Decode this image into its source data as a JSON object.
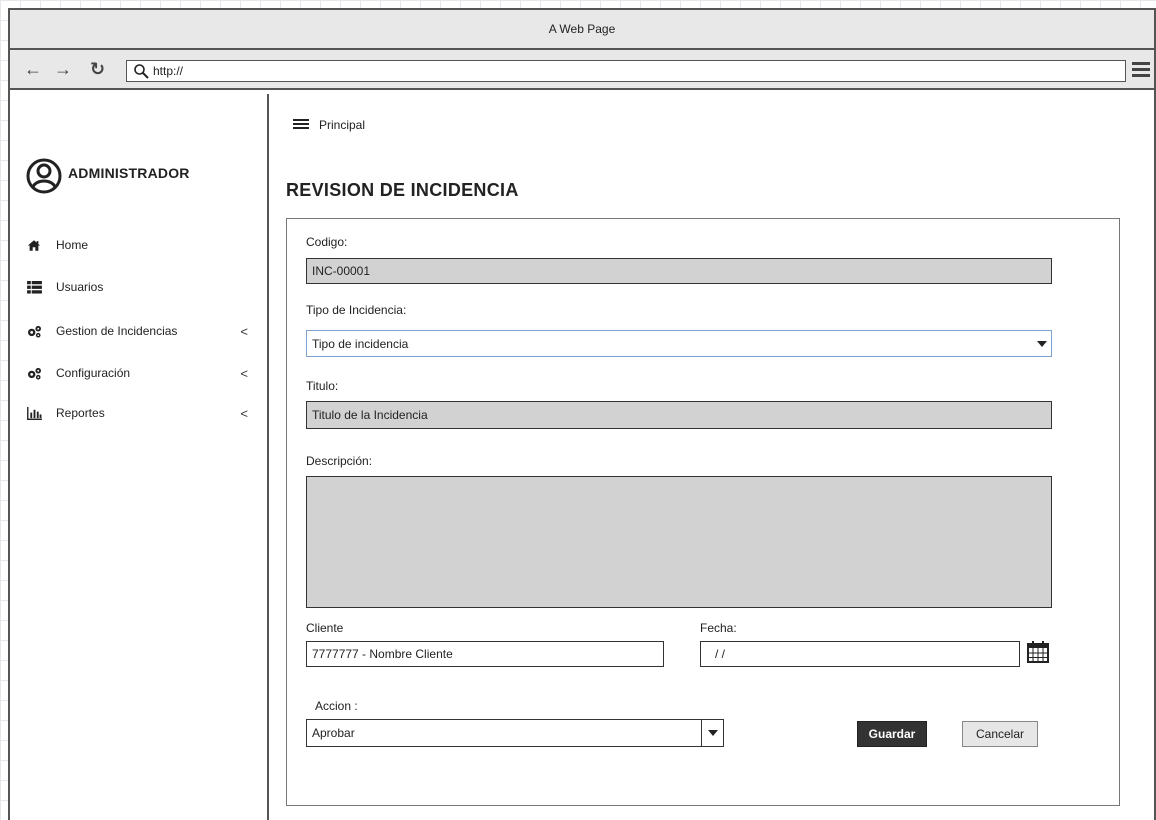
{
  "window": {
    "title": "A Web Page"
  },
  "browser": {
    "url": "http://"
  },
  "sidebar": {
    "user": "ADMINISTRADOR",
    "items": [
      {
        "label": "Home",
        "icon": "home-icon",
        "has_submenu": false
      },
      {
        "label": "Usuarios",
        "icon": "list-icon",
        "has_submenu": false
      },
      {
        "label": "Gestion de Incidencias",
        "icon": "cogs-icon",
        "has_submenu": true
      },
      {
        "label": "Configuración",
        "icon": "cogs-icon",
        "has_submenu": true
      },
      {
        "label": "Reportes",
        "icon": "bar-chart-icon",
        "has_submenu": true
      }
    ],
    "chevron": "<"
  },
  "breadcrumb": {
    "label": "Principal"
  },
  "page": {
    "title": "REVISION DE INCIDENCIA"
  },
  "form": {
    "codigo": {
      "label": "Codigo:",
      "value": "INC-00001"
    },
    "tipo": {
      "label": "Tipo de Incidencia:",
      "value": "Tipo de incidencia"
    },
    "titulo": {
      "label": "Titulo:",
      "value": "Titulo de la Incidencia"
    },
    "descripcion": {
      "label": "Descripción:",
      "value": ""
    },
    "cliente": {
      "label": "Cliente",
      "value": "7777777 - Nombre Cliente"
    },
    "fecha": {
      "label": "Fecha:",
      "value": "/ /"
    },
    "accion": {
      "label": "Accion :",
      "value": "Aprobar"
    },
    "save_label": "Guardar",
    "cancel_label": "Cancelar"
  },
  "colors": {
    "readonly_field": "#d2d2d2",
    "primary_button": "#333333",
    "secondary_button": "#e6e6e6",
    "focus_border": "#7da2ce"
  }
}
